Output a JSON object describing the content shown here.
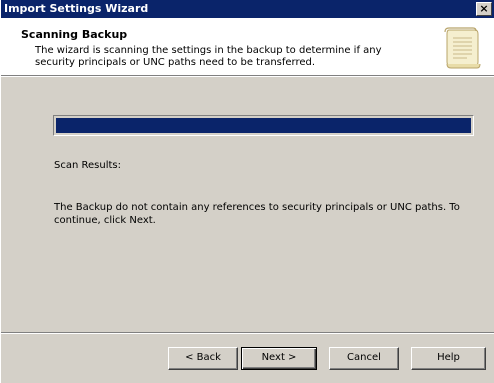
{
  "window": {
    "title": "Import Settings Wizard",
    "close_glyph": "×",
    "close_icon": "close-icon"
  },
  "header": {
    "title": "Scanning Backup",
    "description": "The wizard is scanning the settings in the backup to determine if any security principals or UNC paths need to be transferred.",
    "icon": "scroll-icon"
  },
  "progress": {
    "percent": 100
  },
  "results": {
    "label": "Scan Results:",
    "message": "The Backup do not contain any references to security principals or UNC paths. To continue, click Next."
  },
  "buttons": {
    "back": "< Back",
    "next": "Next >",
    "cancel": "Cancel",
    "help": "Help"
  },
  "colors": {
    "face": "#d4d0c8",
    "titlebar": "#0a246a",
    "progress_fill": "#0a246a",
    "header_bg": "#ffffff"
  }
}
